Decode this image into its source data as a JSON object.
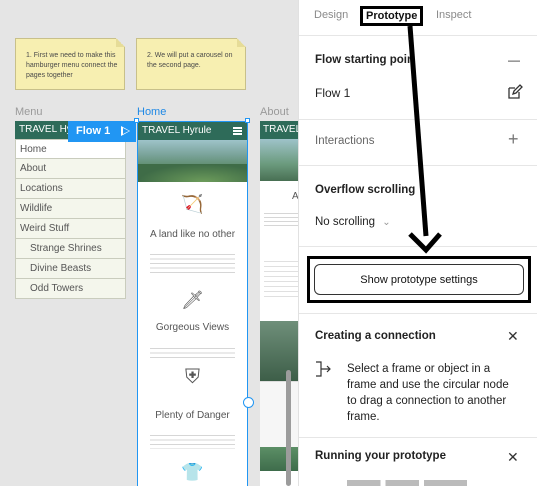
{
  "canvas": {
    "sticky_notes": [
      {
        "text": "1. First we need to make this hamburger menu connect the pages together"
      },
      {
        "text": "2. We will put a carousel on the second page."
      }
    ],
    "frames": {
      "menu": {
        "label": "Menu",
        "header": "TRAVEL Hyr",
        "items": [
          "Home",
          "About",
          "Locations",
          "Wildlife",
          "Weird Stuff"
        ],
        "subitems": [
          "Strange Shrines",
          "Divine Beasts",
          "Odd Towers"
        ]
      },
      "home": {
        "label": "Home",
        "header": "TRAVEL Hyrule",
        "sections": [
          {
            "icon": "bow-arrow-icon",
            "glyph": "🏹",
            "title": "A land like no other"
          },
          {
            "icon": "sword-icon",
            "glyph": "🗡",
            "title": "Gorgeous Views"
          },
          {
            "icon": "shield-icon",
            "glyph": "⛨",
            "title": "Plenty of Danger"
          },
          {
            "icon": "shirt-icon",
            "glyph": "👕",
            "title": ""
          }
        ]
      },
      "about": {
        "label": "About",
        "header": "TRAVEL",
        "initial": "A"
      }
    },
    "flow_badge": "Flow 1"
  },
  "panel": {
    "tabs": [
      "Design",
      "Prototype",
      "Inspect"
    ],
    "active_tab": "Prototype",
    "flow_starting_point": {
      "heading": "Flow starting point",
      "value": "Flow 1",
      "minus": "—"
    },
    "interactions": {
      "heading": "Interactions",
      "plus": "+"
    },
    "overflow": {
      "heading": "Overflow scrolling",
      "value": "No scrolling",
      "chevron": "⌄"
    },
    "settings_button": "Show prototype settings",
    "creating_connection": {
      "heading": "Creating a connection",
      "text": "Select a frame or object in a frame and use the circular node to drag a connection to another frame."
    },
    "running_prototype": {
      "heading": "Running your prototype"
    },
    "close_glyph": "✕"
  },
  "colors": {
    "accent": "#2196f3",
    "header_green": "#2e6b59",
    "sticky": "#f7efb1"
  }
}
